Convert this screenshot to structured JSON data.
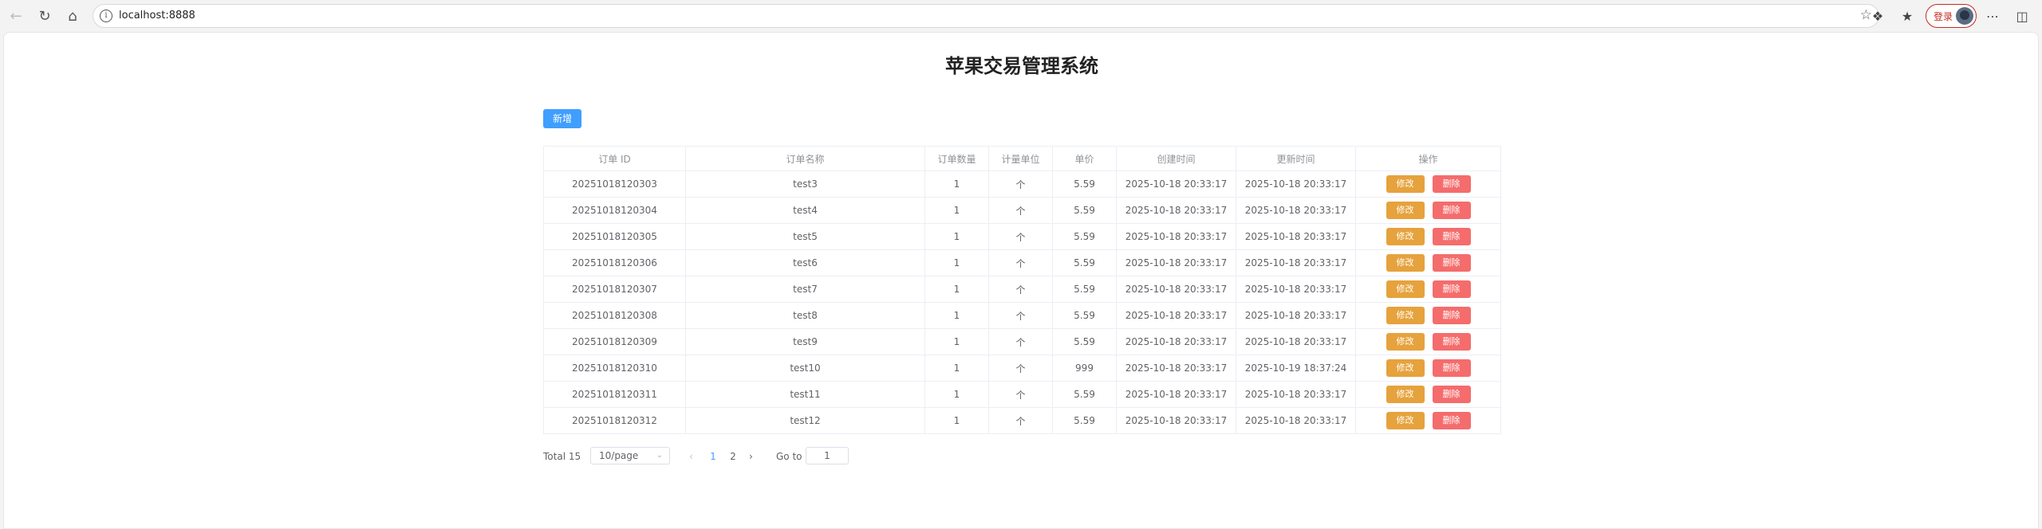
{
  "browser": {
    "url": "localhost:8888",
    "login_label": "登录"
  },
  "page": {
    "title": "苹果交易管理系统",
    "add_label": "新增"
  },
  "table": {
    "headers": [
      "订单 ID",
      "订单名称",
      "订单数量",
      "计量单位",
      "单价",
      "创建时间",
      "更新时间",
      "操作"
    ],
    "edit_label": "修改",
    "delete_label": "删除",
    "rows": [
      [
        "20251018120303",
        "test3",
        "1",
        "个",
        "5.59",
        "2025-10-18 20:33:17",
        "2025-10-18 20:33:17"
      ],
      [
        "20251018120304",
        "test4",
        "1",
        "个",
        "5.59",
        "2025-10-18 20:33:17",
        "2025-10-18 20:33:17"
      ],
      [
        "20251018120305",
        "test5",
        "1",
        "个",
        "5.59",
        "2025-10-18 20:33:17",
        "2025-10-18 20:33:17"
      ],
      [
        "20251018120306",
        "test6",
        "1",
        "个",
        "5.59",
        "2025-10-18 20:33:17",
        "2025-10-18 20:33:17"
      ],
      [
        "20251018120307",
        "test7",
        "1",
        "个",
        "5.59",
        "2025-10-18 20:33:17",
        "2025-10-18 20:33:17"
      ],
      [
        "20251018120308",
        "test8",
        "1",
        "个",
        "5.59",
        "2025-10-18 20:33:17",
        "2025-10-18 20:33:17"
      ],
      [
        "20251018120309",
        "test9",
        "1",
        "个",
        "5.59",
        "2025-10-18 20:33:17",
        "2025-10-18 20:33:17"
      ],
      [
        "20251018120310",
        "test10",
        "1",
        "个",
        "999",
        "2025-10-18 20:33:17",
        "2025-10-19 18:37:24"
      ],
      [
        "20251018120311",
        "test11",
        "1",
        "个",
        "5.59",
        "2025-10-18 20:33:17",
        "2025-10-18 20:33:17"
      ],
      [
        "20251018120312",
        "test12",
        "1",
        "个",
        "5.59",
        "2025-10-18 20:33:17",
        "2025-10-18 20:33:17"
      ]
    ]
  },
  "pagination": {
    "total_label": "Total 15",
    "page_size_label": "10/page",
    "pages": [
      "1",
      "2"
    ],
    "current_page": "1",
    "goto_label": "Go to",
    "goto_value": "1"
  }
}
